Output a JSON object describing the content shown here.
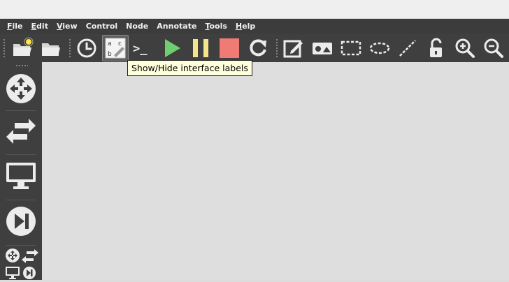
{
  "menubar": {
    "items": [
      {
        "mnemonic": "F",
        "rest": "ile"
      },
      {
        "mnemonic": "E",
        "rest": "dit"
      },
      {
        "mnemonic": "V",
        "rest": "iew"
      },
      {
        "mnemonic": "",
        "rest": "Control"
      },
      {
        "mnemonic": "",
        "rest": "Node"
      },
      {
        "mnemonic": "",
        "rest": "Annotate"
      },
      {
        "mnemonic": "T",
        "rest": "ools"
      },
      {
        "mnemonic": "H",
        "rest": "elp"
      }
    ]
  },
  "toolbar": {
    "icons": [
      "new-project-icon",
      "open-project-icon",
      "snapshot-icon",
      "show-hide-labels-icon",
      "console-icon",
      "start-icon",
      "suspend-icon",
      "stop-icon",
      "reload-icon",
      "add-note-icon",
      "insert-image-icon",
      "draw-rectangle-icon",
      "draw-ellipse-icon",
      "draw-line-icon",
      "lock-icon",
      "zoom-in-icon",
      "zoom-out-icon"
    ],
    "labels_glyph": {
      "a": "a",
      "c": "c",
      "b": "b"
    },
    "console_glyph": ">_"
  },
  "tooltip": {
    "text": "Show/Hide interface labels"
  },
  "colors": {
    "start": "#6fcf6f",
    "suspend": "#f4e48a",
    "stop": "#f07a74",
    "toolbar_bg": "#3f3f3f",
    "canvas_bg": "#dedede"
  }
}
